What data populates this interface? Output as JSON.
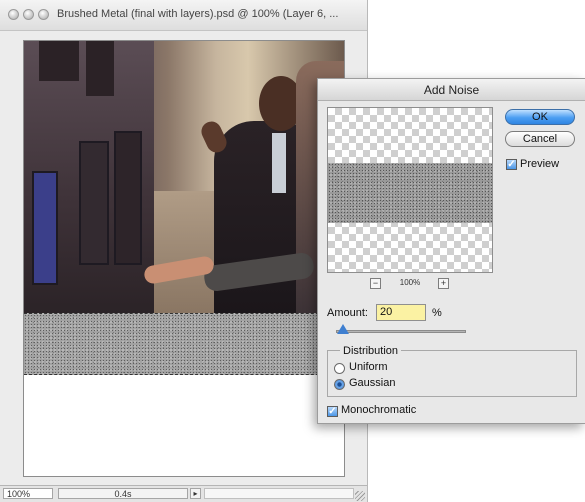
{
  "document": {
    "title": "Brushed Metal (final with layers).psd @ 100% (Layer 6, ...",
    "status": {
      "zoom": "100%",
      "info": "0.4s"
    }
  },
  "dialog": {
    "title": "Add Noise",
    "ok_label": "OK",
    "cancel_label": "Cancel",
    "preview_label": "Preview",
    "preview_checked": true,
    "preview_zoom": "100%",
    "zoom_out_label": "−",
    "zoom_in_label": "+",
    "amount_label": "Amount:",
    "amount_value": "20",
    "amount_unit": "%",
    "amount_percent": 20,
    "distribution": {
      "legend": "Distribution",
      "options": [
        "Uniform",
        "Gaussian"
      ],
      "selected": "Gaussian"
    },
    "monochromatic_label": "Monochromatic",
    "monochromatic_checked": true
  },
  "colors": {
    "default_button": "#4c9ef2",
    "amount_field_highlight": "#fbf2a3",
    "checkbox_blue": "#4b96e6"
  }
}
